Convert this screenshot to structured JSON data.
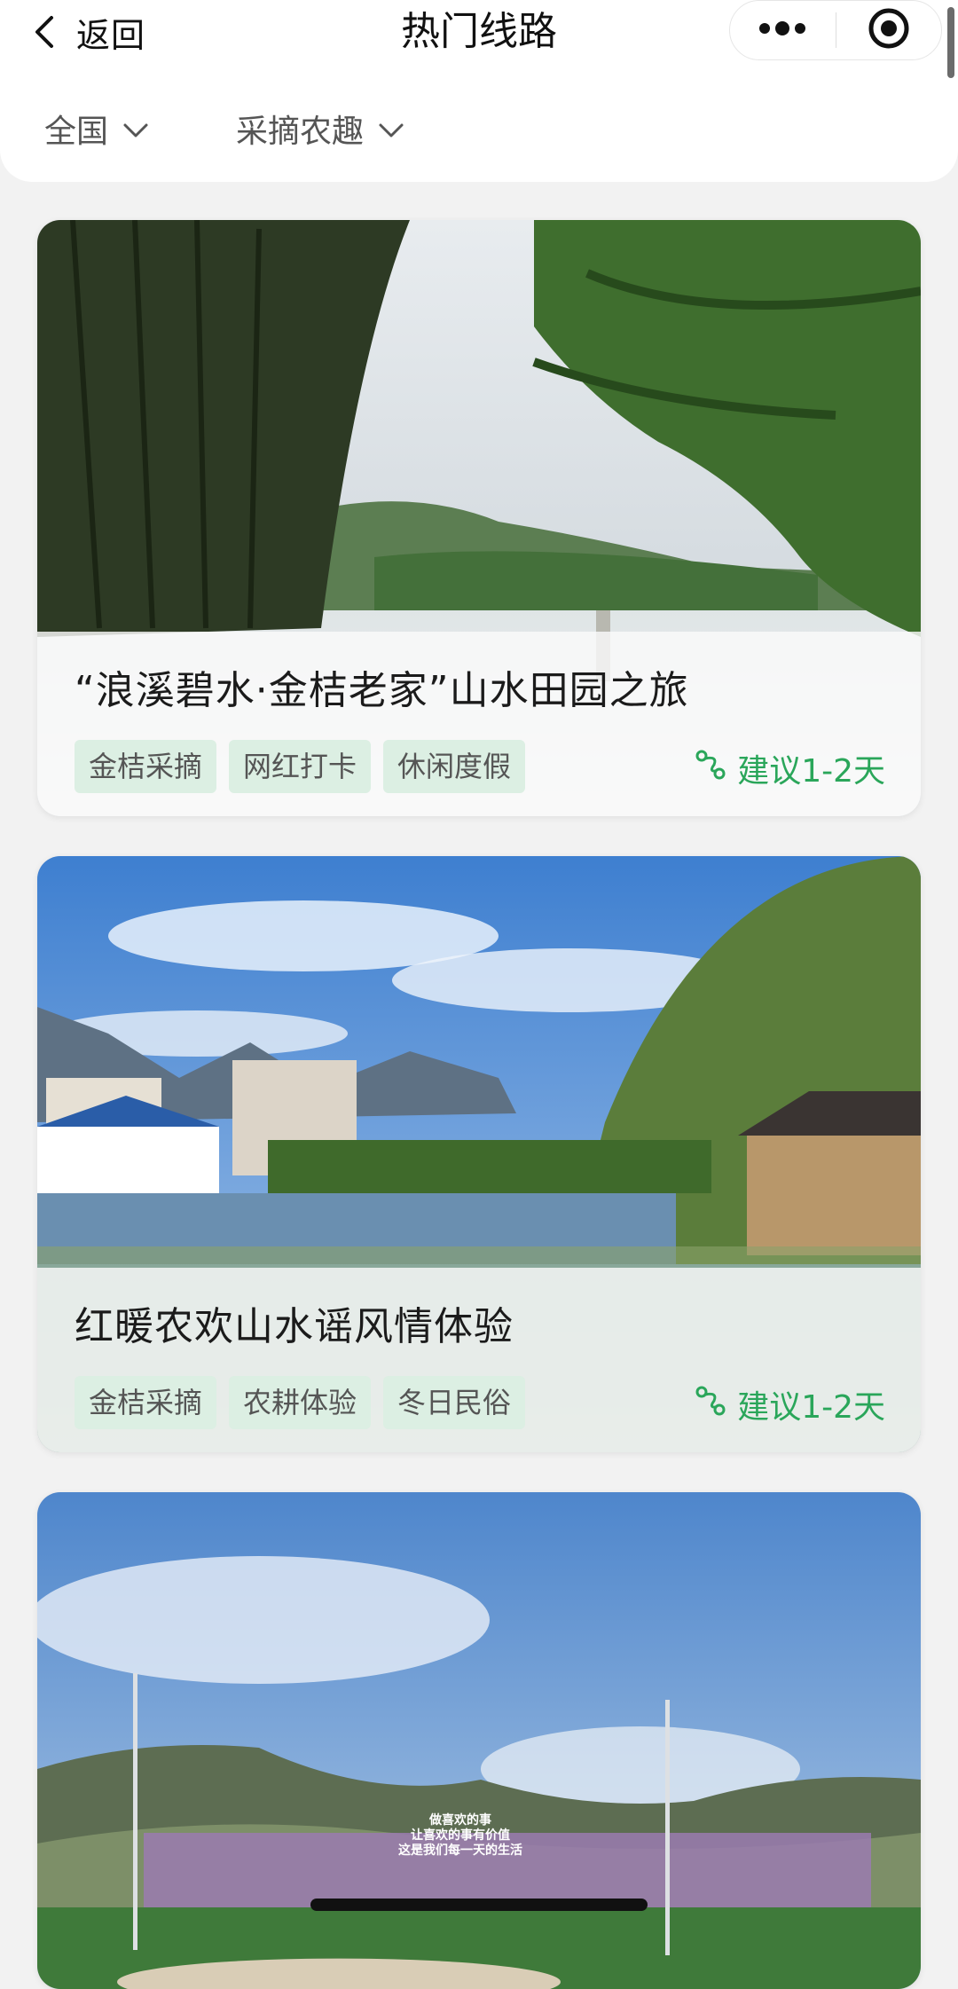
{
  "nav": {
    "back_label": "返回",
    "title": "热门线路"
  },
  "filters": {
    "region": "全国",
    "category": "采摘农趣"
  },
  "routes": [
    {
      "title": "“浪溪碧水·金桔老家”山水田园之旅",
      "tags": [
        "金桔采摘",
        "网红打卡",
        "休闲度假"
      ],
      "duration": "建议1-2天"
    },
    {
      "title": "红暖农欢山水谣风情体验",
      "tags": [
        "金桔采摘",
        "农耕体验",
        "冬日民俗"
      ],
      "duration": "建议1-2天"
    },
    {
      "sign_text": [
        "做喜欢的事",
        "让喜欢的事有价值",
        "这是我们每一天的生活"
      ]
    }
  ],
  "icons": {
    "back": "chevron-left-icon",
    "more": "more-dots-icon",
    "home": "target-circle-icon",
    "dropdown": "chevron-down-icon",
    "duration": "route-icon"
  },
  "colors": {
    "accent_green": "#2aa65a",
    "tag_bg": "#dcefe3",
    "selection_outline": "#d9212c"
  }
}
